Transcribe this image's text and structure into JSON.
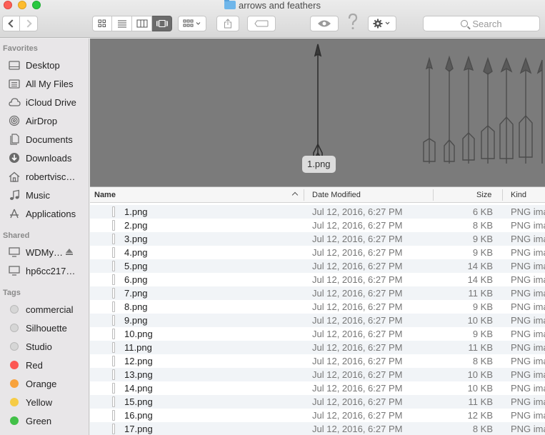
{
  "window": {
    "title": "arrows and feathers"
  },
  "toolbar": {
    "view_modes": [
      "icon-view",
      "list-view",
      "column-view",
      "cover-flow-view"
    ],
    "active_view": "cover-flow-view",
    "search_placeholder": "Search"
  },
  "sidebar": {
    "favorites_heading": "Favorites",
    "favorites": [
      {
        "label": "Desktop",
        "icon": "desktop-icon"
      },
      {
        "label": "All My Files",
        "icon": "all-files-icon"
      },
      {
        "label": "iCloud Drive",
        "icon": "cloud-icon"
      },
      {
        "label": "AirDrop",
        "icon": "airdrop-icon"
      },
      {
        "label": "Documents",
        "icon": "documents-icon"
      },
      {
        "label": "Downloads",
        "icon": "downloads-icon"
      },
      {
        "label": "robertvisc…",
        "icon": "home-icon"
      },
      {
        "label": "Music",
        "icon": "music-icon"
      },
      {
        "label": "Applications",
        "icon": "applications-icon"
      }
    ],
    "shared_heading": "Shared",
    "shared": [
      {
        "label": "WDMy…",
        "icon": "display-icon",
        "ejectable": true
      },
      {
        "label": "hp6cc217…",
        "icon": "display-icon",
        "ejectable": false
      }
    ],
    "tags_heading": "Tags",
    "tags": [
      {
        "label": "commercial",
        "color": "#d6d6d6"
      },
      {
        "label": "Silhouette",
        "color": "#d6d6d6"
      },
      {
        "label": "Studio",
        "color": "#d6d6d6"
      },
      {
        "label": "Red",
        "color": "#fc5753"
      },
      {
        "label": "Orange",
        "color": "#f8a23c"
      },
      {
        "label": "Yellow",
        "color": "#f6cc46"
      },
      {
        "label": "Green",
        "color": "#42c048"
      }
    ]
  },
  "preview": {
    "selected_label": "1.png"
  },
  "list": {
    "columns": {
      "name": "Name",
      "date": "Date Modified",
      "size": "Size",
      "kind": "Kind"
    },
    "rows": [
      {
        "name": "1.png",
        "date": "Jul 12, 2016, 6:27 PM",
        "size": "6 KB",
        "kind": "PNG ima"
      },
      {
        "name": "2.png",
        "date": "Jul 12, 2016, 6:27 PM",
        "size": "8 KB",
        "kind": "PNG ima"
      },
      {
        "name": "3.png",
        "date": "Jul 12, 2016, 6:27 PM",
        "size": "9 KB",
        "kind": "PNG ima"
      },
      {
        "name": "4.png",
        "date": "Jul 12, 2016, 6:27 PM",
        "size": "9 KB",
        "kind": "PNG ima"
      },
      {
        "name": "5.png",
        "date": "Jul 12, 2016, 6:27 PM",
        "size": "14 KB",
        "kind": "PNG ima"
      },
      {
        "name": "6.png",
        "date": "Jul 12, 2016, 6:27 PM",
        "size": "14 KB",
        "kind": "PNG ima"
      },
      {
        "name": "7.png",
        "date": "Jul 12, 2016, 6:27 PM",
        "size": "11 KB",
        "kind": "PNG ima"
      },
      {
        "name": "8.png",
        "date": "Jul 12, 2016, 6:27 PM",
        "size": "9 KB",
        "kind": "PNG ima"
      },
      {
        "name": "9.png",
        "date": "Jul 12, 2016, 6:27 PM",
        "size": "10 KB",
        "kind": "PNG ima"
      },
      {
        "name": "10.png",
        "date": "Jul 12, 2016, 6:27 PM",
        "size": "9 KB",
        "kind": "PNG ima"
      },
      {
        "name": "11.png",
        "date": "Jul 12, 2016, 6:27 PM",
        "size": "11 KB",
        "kind": "PNG ima"
      },
      {
        "name": "12.png",
        "date": "Jul 12, 2016, 6:27 PM",
        "size": "8 KB",
        "kind": "PNG ima"
      },
      {
        "name": "13.png",
        "date": "Jul 12, 2016, 6:27 PM",
        "size": "10 KB",
        "kind": "PNG ima"
      },
      {
        "name": "14.png",
        "date": "Jul 12, 2016, 6:27 PM",
        "size": "10 KB",
        "kind": "PNG ima"
      },
      {
        "name": "15.png",
        "date": "Jul 12, 2016, 6:27 PM",
        "size": "11 KB",
        "kind": "PNG ima"
      },
      {
        "name": "16.png",
        "date": "Jul 12, 2016, 6:27 PM",
        "size": "12 KB",
        "kind": "PNG ima"
      },
      {
        "name": "17.png",
        "date": "Jul 12, 2016, 6:27 PM",
        "size": "8 KB",
        "kind": "PNG ima"
      }
    ]
  }
}
